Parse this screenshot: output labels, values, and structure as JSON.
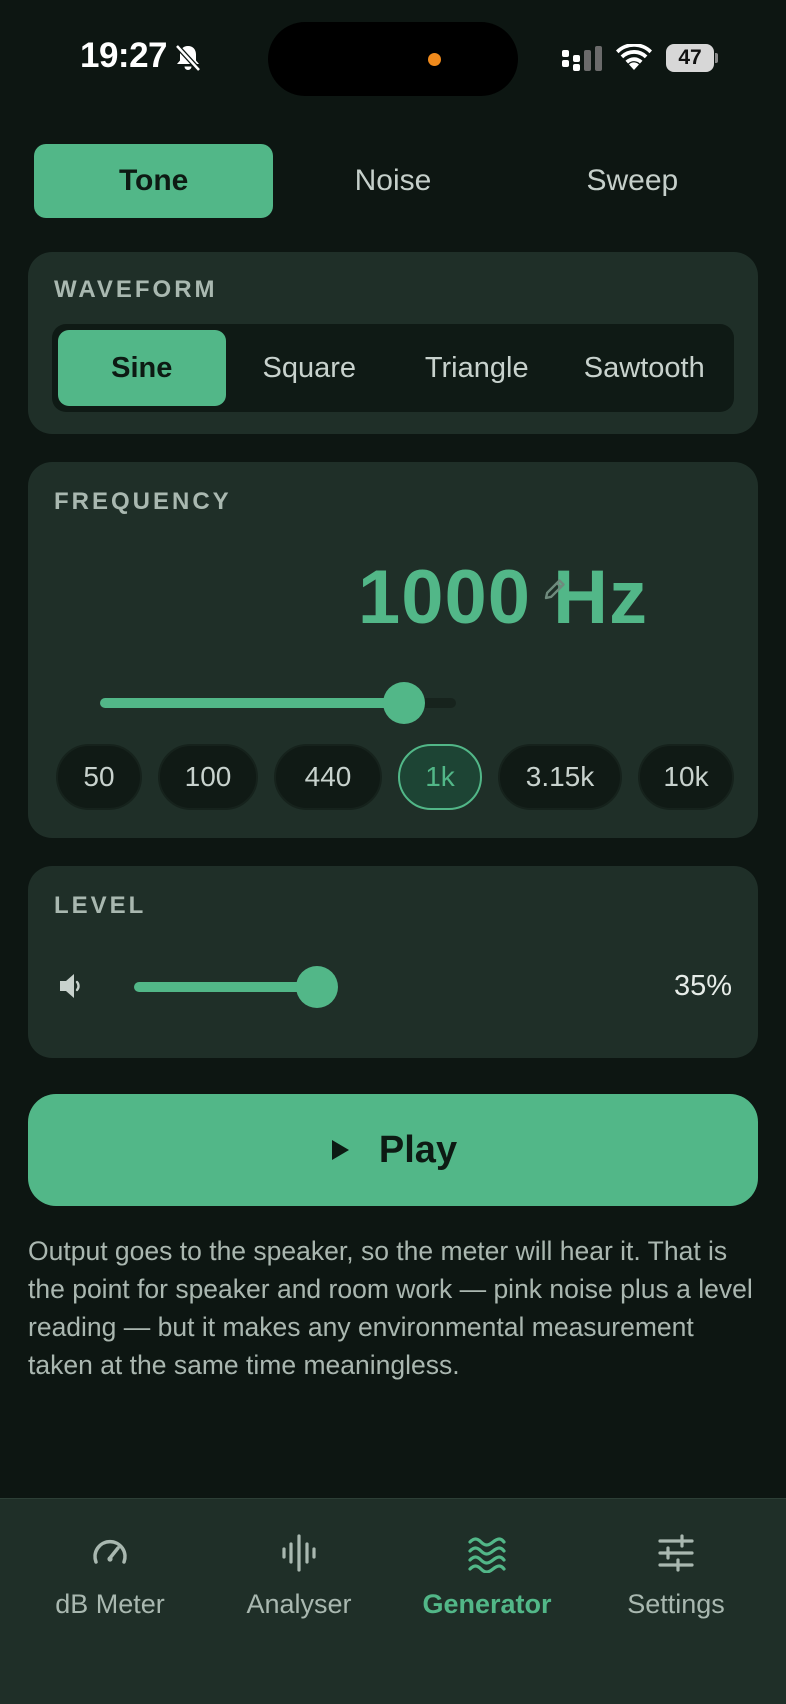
{
  "status": {
    "time": "19:27",
    "battery": "47"
  },
  "mode_tabs": [
    {
      "label": "Tone",
      "active": true
    },
    {
      "label": "Noise",
      "active": false
    },
    {
      "label": "Sweep",
      "active": false
    }
  ],
  "waveform": {
    "title": "WAVEFORM",
    "options": [
      {
        "label": "Sine",
        "active": true
      },
      {
        "label": "Square",
        "active": false
      },
      {
        "label": "Triangle",
        "active": false
      },
      {
        "label": "Sawtooth",
        "active": false
      }
    ]
  },
  "frequency": {
    "title": "FREQUENCY",
    "value": "1000 Hz",
    "slider_fraction": 0.9,
    "presets": [
      {
        "label": "50",
        "active": false
      },
      {
        "label": "100",
        "active": false
      },
      {
        "label": "440",
        "active": false
      },
      {
        "label": "1k",
        "active": true
      },
      {
        "label": "3.15k",
        "active": false
      },
      {
        "label": "10k",
        "active": false
      }
    ]
  },
  "level": {
    "title": "LEVEL",
    "percent_label": "35%",
    "fraction": 0.35
  },
  "play": {
    "label": "Play"
  },
  "note": "Output goes to the speaker, so the meter will hear it. That is the point for speaker and room work — pink noise plus a level reading — but it makes any environmental measurement taken at the same time meaningless.",
  "tabbar": [
    {
      "label": "dB Meter",
      "icon": "gauge-icon",
      "active": false
    },
    {
      "label": "Analyser",
      "icon": "waveform-bars-icon",
      "active": false
    },
    {
      "label": "Generator",
      "icon": "waves-icon",
      "active": true
    },
    {
      "label": "Settings",
      "icon": "sliders-icon",
      "active": false
    }
  ],
  "colors": {
    "accent": "#52b788",
    "background": "#0d1612",
    "card": "#1f2f28",
    "muted_text": "#a9b8b0"
  }
}
